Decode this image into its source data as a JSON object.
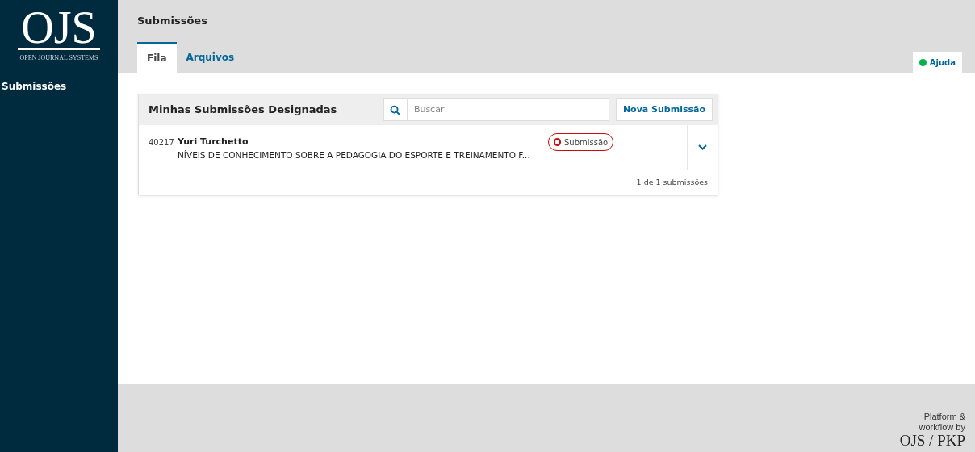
{
  "sidebar": {
    "logo": {
      "mark": "OJS",
      "subtitle": "OPEN JOURNAL SYSTEMS"
    },
    "items": [
      {
        "label": "Submissões",
        "selected": true
      }
    ]
  },
  "header": {
    "title": "Submissões",
    "tabs": [
      {
        "label": "Fila",
        "selected": true
      },
      {
        "label": "Arquivos",
        "selected": false
      }
    ],
    "help": "Ajuda"
  },
  "panel": {
    "title": "Minhas Submissões Designadas",
    "search": {
      "placeholder": "Buscar"
    },
    "new_button": "Nova Submissão",
    "rows": [
      {
        "id": "40217",
        "author": "Yuri Turchetto",
        "title": "NÍVEIS DE CONHECIMENTO SOBRE A PEDAGOGIA DO ESPORTE E TREINAMENTO F...",
        "stage": "Submissão",
        "color": "#d00a0a",
        "expanded": false
      }
    ],
    "count": "1 de 1 submissões"
  },
  "footer": {
    "line1": "Platform &",
    "line2": "workflow by",
    "brand": "OJS / PKP"
  }
}
